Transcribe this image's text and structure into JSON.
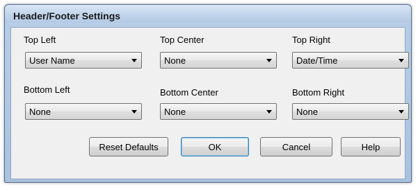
{
  "window": {
    "title": "Header/Footer Settings"
  },
  "fields": {
    "top_left": {
      "label": "Top Left",
      "value": "User Name"
    },
    "top_center": {
      "label": "Top Center",
      "value": "None"
    },
    "top_right": {
      "label": "Top Right",
      "value": "Date/Time"
    },
    "bottom_left": {
      "label": "Bottom Left",
      "value": "None"
    },
    "bottom_center": {
      "label": "Bottom Center",
      "value": "None"
    },
    "bottom_right": {
      "label": "Bottom Right",
      "value": "None"
    }
  },
  "buttons": {
    "reset": "Reset Defaults",
    "ok": "OK",
    "cancel": "Cancel",
    "help": "Help"
  },
  "icons": {
    "dropdown": "chevron-down-icon"
  }
}
